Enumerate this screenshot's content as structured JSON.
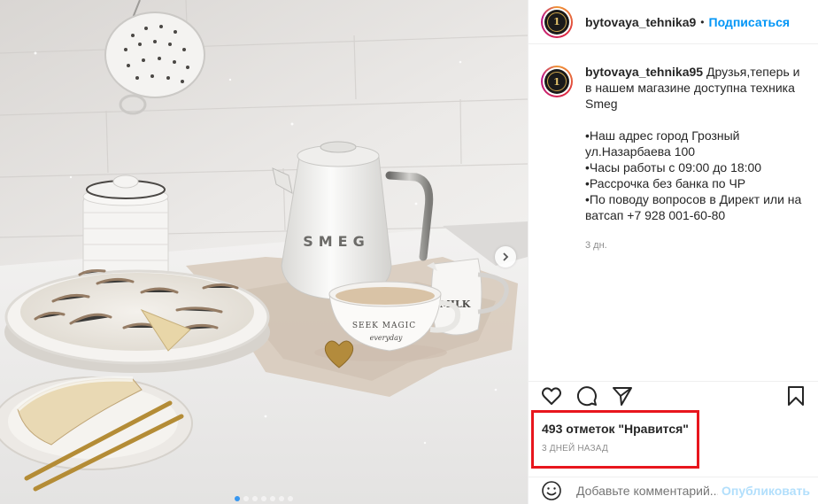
{
  "post": {
    "username": "bytovaya_tehnika9",
    "separator": "•",
    "follow_label": "Подписаться",
    "avatar_logo_text": "1",
    "caption": {
      "author": "bytovaya_tehnika95",
      "text": " Друзья,теперь и в нашем магазине доступна техника Smeg\n\n•Наш адрес город Грозный ул.Назарбаева 100\n•Часы работы с 09:00 до 18:00\n•Рассрочка без банка по ЧР\n•По поводу вопросов в Директ или на ватсап +7 928 001-60-80",
      "time": "3 дн."
    },
    "likes": "493 отметок \"Нравится\"",
    "posted_ago": "3 ДНЕЙ НАЗАД",
    "comment": {
      "placeholder": "Добавьте комментарий...",
      "publish_label": "Опубликовать"
    },
    "photo": {
      "kettle_brand": "SMEG",
      "cup_text_1": "SEEK MAGIC",
      "cup_text_2": "everyday",
      "jug_text": "MILK"
    },
    "carousel": {
      "total": 7,
      "active_index": 0
    },
    "icons": [
      "heart-icon",
      "comment-icon",
      "share-icon",
      "bookmark-icon",
      "smile-icon",
      "chevron-right-icon"
    ],
    "colors": {
      "accent": "#0095f6",
      "highlight_box": "#e8161d",
      "muted": "#8e8e8e"
    }
  }
}
